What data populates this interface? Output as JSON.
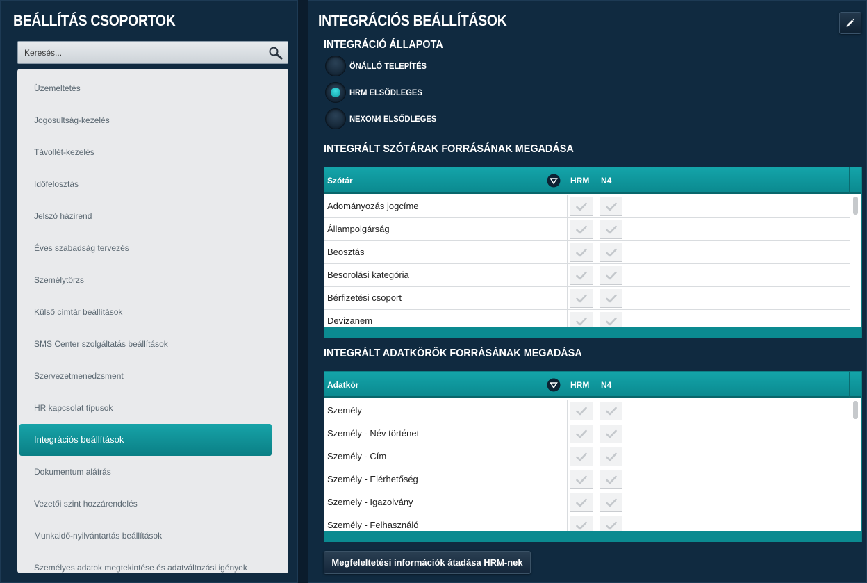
{
  "left": {
    "title": "BEÁLLÍTÁS CSOPORTOK",
    "search": {
      "placeholder": "Keresés..."
    },
    "groups": [
      "Üzemeltetés",
      "Jogosultság-kezelés",
      "Távollét-kezelés",
      "Időfelosztás",
      "Jelszó házirend",
      "Éves szabadság tervezés",
      "Személytörzs",
      "Külső címtár beállítások",
      "SMS Center szolgáltatás beállítások",
      "Szervezetmenedzsment",
      "HR kapcsolat típusok",
      "Integrációs beállítások",
      "Dokumentum aláírás",
      "Vezetői szint hozzárendelés",
      "Munkaidő-nyilvántartás beállítások",
      "Személyes adatok megtekintése és adatváltozási igények"
    ],
    "selected_group": "Integrációs beállítások"
  },
  "right": {
    "title": "INTEGRÁCIÓS BEÁLLÍTÁSOK",
    "status_title": "INTEGRÁCIÓ ÁLLAPOTA",
    "status_options": [
      "ÖNÁLLÓ TELEPÍTÉS",
      "HRM ELSŐDLEGES",
      "NEXON4 ELSŐDLEGES"
    ],
    "status_selected": "HRM ELSŐDLEGES",
    "dict_section_title": "INTEGRÁLT SZÓTÁRAK FORRÁSÁNAK MEGADÁSA",
    "dict_grid": {
      "col_name": "Szótár",
      "col_hrm": "HRM",
      "col_n4": "N4",
      "rows": [
        "Adományozás jogcíme",
        "Állampolgárság",
        "Beosztás",
        "Besorolási kategória",
        "Bérfizetési csoport",
        "Devizanem"
      ]
    },
    "data_section_title": "INTEGRÁLT ADATKÖRÖK FORRÁSÁNAK MEGADÁSA",
    "data_grid": {
      "col_name": "Adatkör",
      "col_hrm": "HRM",
      "col_n4": "N4",
      "rows": [
        "Személy",
        "Személy - Név történet",
        "Személy - Cím",
        "Személy - Elérhetőség",
        "Szemely - Igazolvány",
        "Személy - Felhasználó"
      ]
    },
    "transfer_button": "Megfeleltetési információk átadása HRM-nek"
  },
  "colors": {
    "background": "#0b1c2c",
    "panel": "#102a40",
    "accent_teal": "#0b8a90",
    "list_background": "#e9eaec"
  }
}
